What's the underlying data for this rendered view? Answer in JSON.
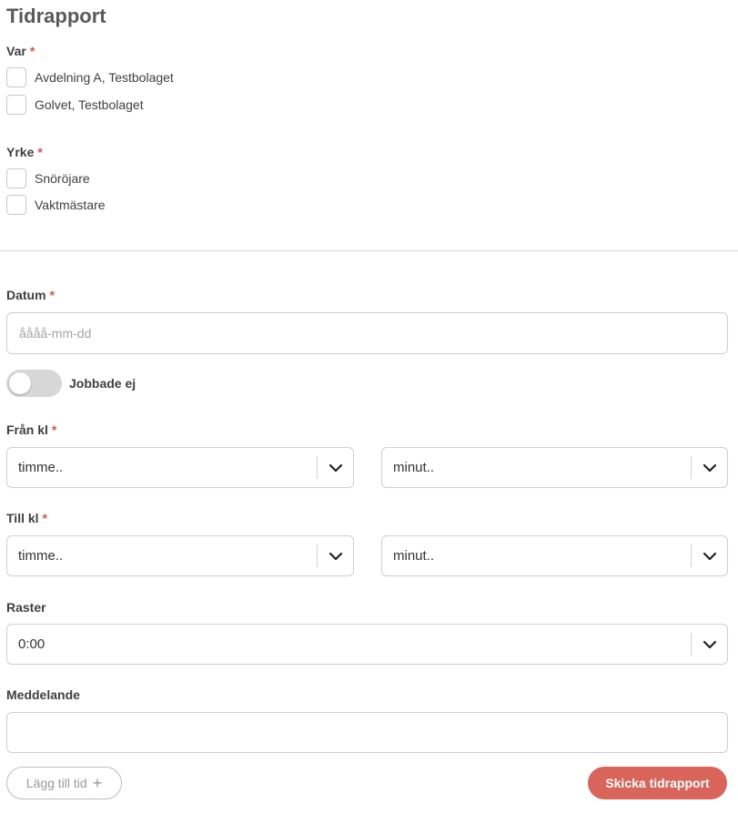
{
  "title": "Tidrapport",
  "required_marker": "*",
  "var": {
    "label": "Var",
    "options": [
      "Avdelning A, Testbolaget",
      "Golvet, Testbolaget"
    ]
  },
  "yrke": {
    "label": "Yrke",
    "options": [
      "Snöröjare",
      "Vaktmästare"
    ]
  },
  "datum": {
    "label": "Datum",
    "placeholder": "åååå-mm-dd",
    "value": ""
  },
  "jobbade_ej": {
    "label": "Jobbade ej",
    "on": false
  },
  "fran_kl": {
    "label": "Från kl",
    "hour": "timme..",
    "minute": "minut.."
  },
  "till_kl": {
    "label": "Till kl",
    "hour": "timme..",
    "minute": "minut.."
  },
  "raster": {
    "label": "Raster",
    "value": "0:00"
  },
  "meddelande": {
    "label": "Meddelande",
    "value": ""
  },
  "buttons": {
    "add_time": "Lägg till tid",
    "submit": "Skicka tidrapport"
  },
  "icons": {
    "select_arrow": "chevron-down-icon",
    "add": "plus-icon"
  },
  "colors": {
    "accent": "#d9655a",
    "required": "#d9534f"
  }
}
